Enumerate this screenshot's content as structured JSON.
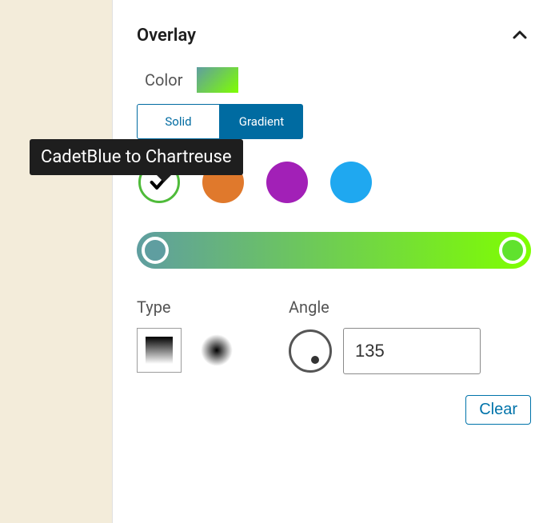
{
  "section": {
    "title": "Overlay"
  },
  "color": {
    "label": "Color",
    "gradient_css": "linear-gradient(135deg,#5f9ea0 0%,#7fff00 100%)"
  },
  "tabs": {
    "solid": "Solid",
    "gradient": "Gradient",
    "active": "gradient"
  },
  "tooltip": {
    "text": "CadetBlue to Chartreuse"
  },
  "swatches": [
    {
      "name": "cadetblue-chartreuse",
      "selected": true
    },
    {
      "name": "orange",
      "color": "#e0792c"
    },
    {
      "name": "purple",
      "color": "#a220b7"
    },
    {
      "name": "blue",
      "color": "#1fa8f0"
    }
  ],
  "gradient_stops": {
    "start": "#5f9ea0",
    "end": "#7fff00"
  },
  "type": {
    "label": "Type",
    "selected": "linear"
  },
  "angle": {
    "label": "Angle",
    "value": "135"
  },
  "buttons": {
    "clear": "Clear"
  }
}
